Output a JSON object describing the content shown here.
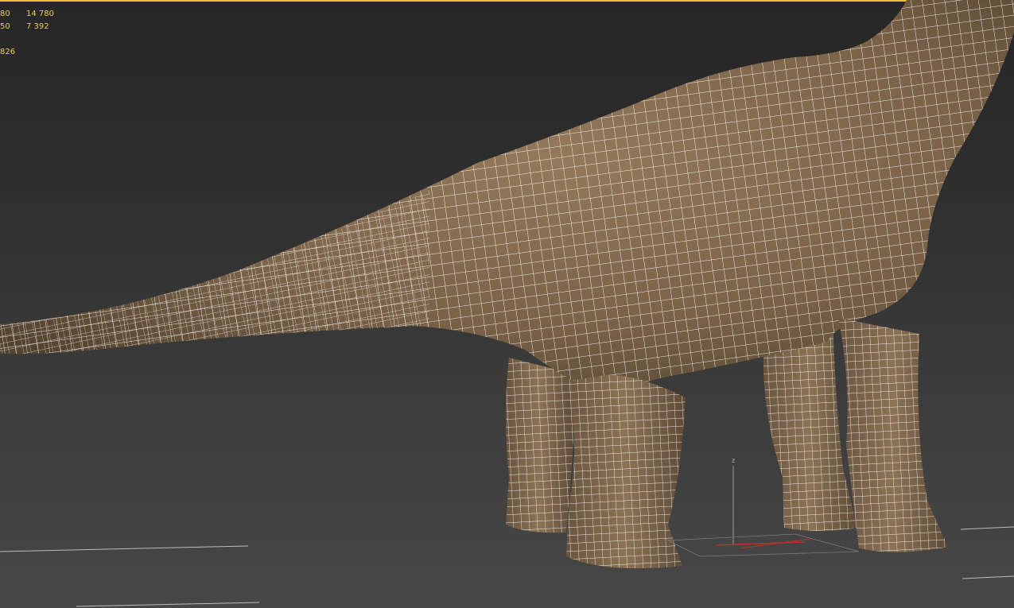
{
  "viewport": {
    "stats": {
      "header_partial": "",
      "rows": [
        {
          "key": "80",
          "value": "14 780"
        },
        {
          "key": "50",
          "value": "7 392"
        }
      ],
      "extra": "826"
    },
    "gizmo": {
      "axis_z": "z"
    },
    "colors": {
      "active_border": "#e8c33a",
      "stats_text": "#e8d24a",
      "wire": "#ffffff",
      "skin": "#8a6f52"
    }
  }
}
